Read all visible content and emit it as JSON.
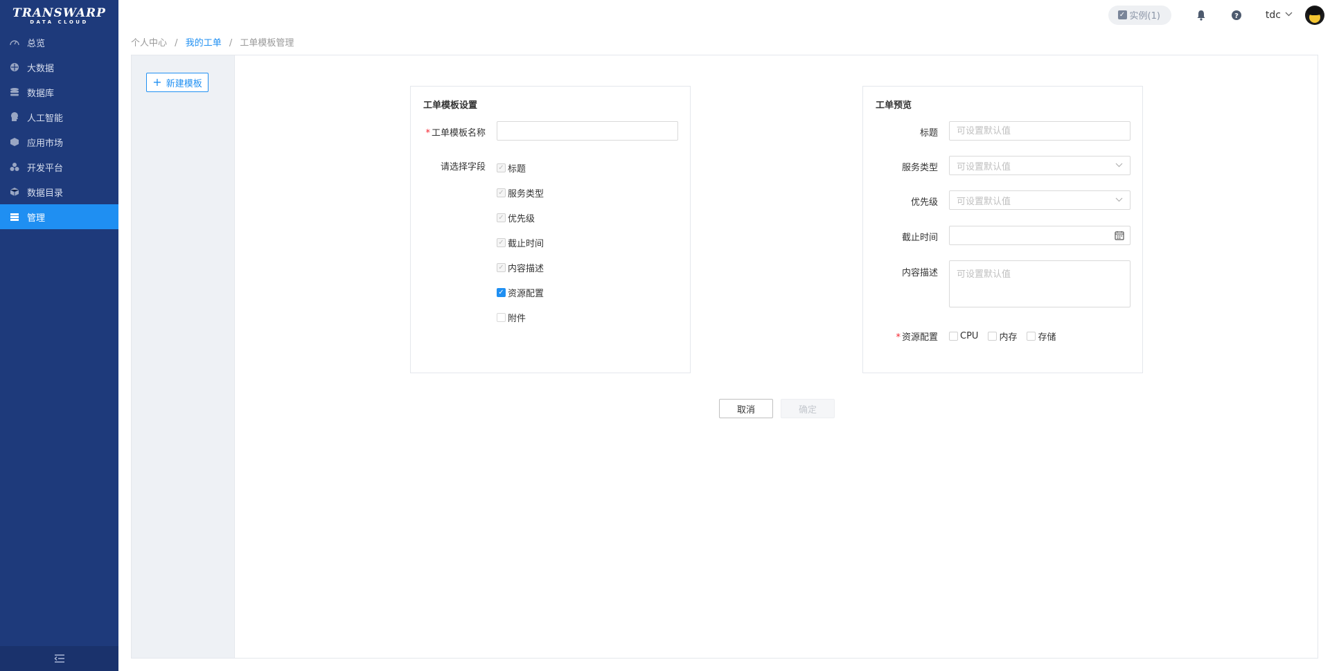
{
  "logo": {
    "main": "TRANSWARP",
    "sub": "DATA CLOUD"
  },
  "sidebar": {
    "items": [
      {
        "label": "总览",
        "icon": "dashboard-icon",
        "active": false
      },
      {
        "label": "大数据",
        "icon": "big-data-icon",
        "active": false
      },
      {
        "label": "数据库",
        "icon": "database-icon",
        "active": false
      },
      {
        "label": "人工智能",
        "icon": "ai-icon",
        "active": false
      },
      {
        "label": "应用市场",
        "icon": "app-market-icon",
        "active": false
      },
      {
        "label": "开发平台",
        "icon": "dev-platform-icon",
        "active": false
      },
      {
        "label": "数据目录",
        "icon": "data-catalog-icon",
        "active": false
      },
      {
        "label": "管理",
        "icon": "manage-icon",
        "active": true
      }
    ]
  },
  "header": {
    "instance_label": "实例(1)",
    "username": "tdc"
  },
  "breadcrumb": [
    "个人中心",
    "我的工单",
    "工单模板管理"
  ],
  "left_panel": {
    "new_template_label": "新建模板"
  },
  "settings_card": {
    "title": "工单模板设置",
    "name_label": "工单模板名称",
    "name_value": "",
    "fields_label": "请选择字段",
    "fields": [
      {
        "label": "标题",
        "state": "disabled-checked"
      },
      {
        "label": "服务类型",
        "state": "disabled-checked"
      },
      {
        "label": "优先级",
        "state": "disabled-checked"
      },
      {
        "label": "截止时间",
        "state": "disabled-checked"
      },
      {
        "label": "内容描述",
        "state": "disabled-checked"
      },
      {
        "label": "资源配置",
        "state": "checked"
      },
      {
        "label": "附件",
        "state": "unchecked"
      }
    ]
  },
  "preview_card": {
    "title": "工单预览",
    "title_label": "标题",
    "title_placeholder": "可设置默认值",
    "service_type_label": "服务类型",
    "service_type_placeholder": "可设置默认值",
    "priority_label": "优先级",
    "priority_placeholder": "可设置默认值",
    "deadline_label": "截止时间",
    "description_label": "内容描述",
    "description_placeholder": "可设置默认值",
    "resource_label": "资源配置",
    "resource_options": [
      "CPU",
      "内存",
      "存储"
    ]
  },
  "actions": {
    "cancel": "取消",
    "confirm": "确定"
  }
}
